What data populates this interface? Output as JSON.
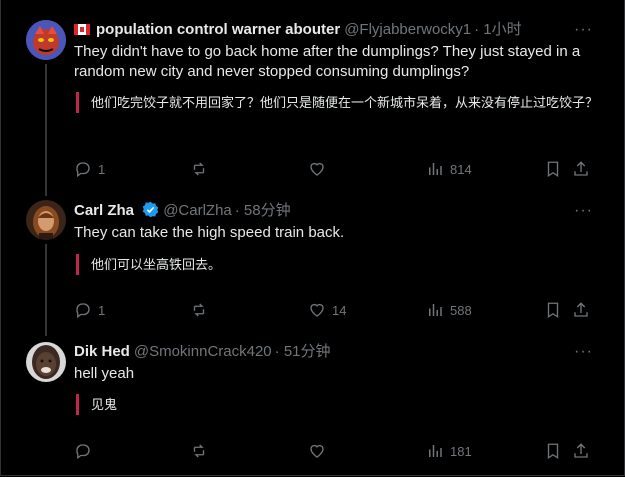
{
  "posts": [
    {
      "display_name": "population control warner abouter",
      "handle": "@Flyjabberwocky1",
      "time": "· 1小时",
      "text": "They didn't have to go back home after the dumplings? They just stayed in a random new city and never stopped consuming dumplings?",
      "translation": "他们吃完饺子就不用回家了？他们只是随便在一个新城市呆着，从来没有停止过吃饺子？",
      "replies": "1",
      "reposts": "",
      "likes": "",
      "views": "814"
    },
    {
      "display_name": "Carl Zha",
      "handle": "@CarlZha",
      "time": "· 58分钟",
      "text": "They can take the high speed train back.",
      "translation": "他们可以坐高铁回去。",
      "replies": "1",
      "reposts": "",
      "likes": "14",
      "views": "588"
    },
    {
      "display_name": "Dik Hed",
      "handle": "@SmokinnCrack420",
      "time": "· 51分钟",
      "text": "hell yeah",
      "translation": "见鬼",
      "replies": "",
      "reposts": "",
      "likes": "",
      "views": "181"
    }
  ],
  "more_label": "···",
  "colors": {
    "background": "#000000",
    "text": "#e7e9ea",
    "muted": "#71767b",
    "verified": "#1d9bf0",
    "translation_bar": "#c2264b"
  },
  "icons": [
    "canada-flag-icon",
    "verified-badge-icon",
    "more-icon",
    "reply-icon",
    "repost-icon",
    "like-icon",
    "views-icon",
    "bookmark-icon",
    "share-icon"
  ]
}
